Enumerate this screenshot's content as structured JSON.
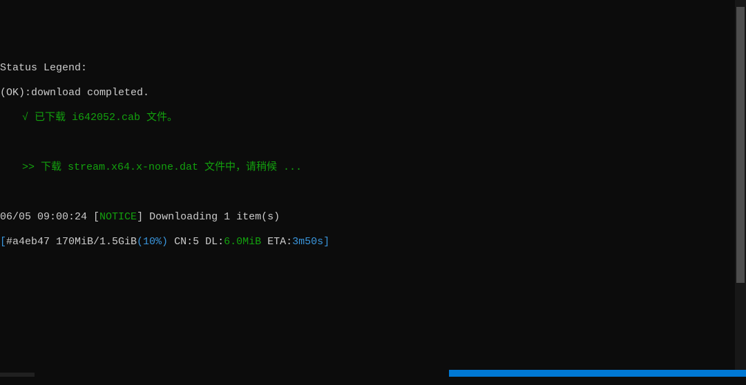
{
  "lines": {
    "legend_title": "Status Legend:",
    "legend_ok": "(OK):download completed.",
    "downloaded_check": "√ ",
    "downloaded_text": "已下载 i642052.cab 文件。",
    "downloading_arrow": ">> ",
    "downloading_text": "下载 stream.x64.x-none.dat 文件中，请稍候 ...",
    "timestamp": "06/05 09:00:24 ",
    "notice_open": "[",
    "notice_label": "NOTICE",
    "notice_close": "]",
    "notice_text": " Downloading 1 item(s)",
    "progress_open": "[",
    "progress_id": "#a4eb47 170MiB/1.5GiB",
    "progress_pct": "(10%)",
    "progress_cn": " CN:5 DL:",
    "progress_dl": "6.0MiB",
    "progress_eta_label": " ETA:",
    "progress_eta": "3m50s",
    "progress_close": "]"
  }
}
